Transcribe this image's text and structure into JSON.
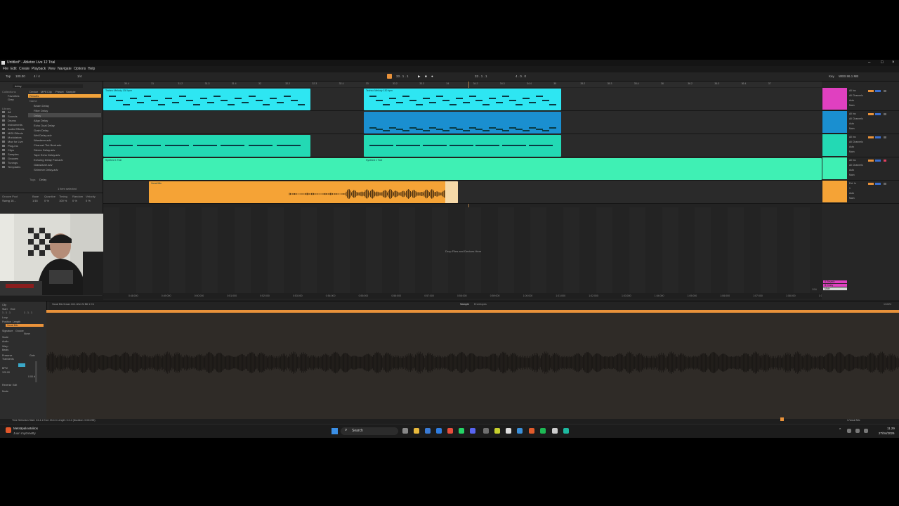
{
  "window": {
    "title": "Untitled* - Ableton Live 12 Trial"
  },
  "menu": [
    "File",
    "Edit",
    "Create",
    "Playback",
    "View",
    "Navigate",
    "Options",
    "Help"
  ],
  "transport": {
    "tap": "Tap",
    "bpm": "100.00",
    "time_sig": "4 / 4",
    "quantize": "1/4",
    "position": "33 . 1 . 1",
    "loop_length": "4 . 0 . 0",
    "keys": "Key",
    "midi": "MIDI",
    "cpu": "WEB 86.1 MB"
  },
  "browser": {
    "search": "delay",
    "filter_tabs": [
      "Device",
      "MPE",
      "Clip",
      "Preset",
      "Sample"
    ],
    "collections_label": "Collections",
    "collections": [
      "Favorites",
      "Grey"
    ],
    "library_label": "Library",
    "library": [
      "All",
      "Sounds",
      "Drums",
      "Instruments",
      "Audio Effects",
      "MIDI Effects",
      "Modulators",
      "Max for Live",
      "Plug-Ins",
      "Clips",
      "Samples",
      "Grooves",
      "Tunings",
      "Templates"
    ],
    "results_label": "Results",
    "results_header": "Name",
    "results": [
      "Beam Delay",
      "Filter Delay",
      "Delay",
      "Align Delay",
      "Echo Dual Delay",
      "Grain Delay",
      "Wet Delay.adv",
      "Wanderer.adv",
      "Channel Tint Beat.adv",
      "Stereo Delay.adv",
      "Tape Echo Delay.adv",
      "Echoing Delay Pad.adv",
      "Glassdune.adv",
      "Shimmer Delay.adv"
    ],
    "tags_label": "Tags",
    "tags_value": "Delay",
    "selected_count": "1 item selected",
    "groove_cols": [
      "Groove Pool",
      "Base",
      "Quantize",
      "Timing",
      "Random",
      "Velocity"
    ],
    "groove_row": [
      "Swing 16...",
      "1/16",
      "0 %",
      "100 %",
      "0 %",
      "0 %"
    ]
  },
  "ruler": [
    "30.4",
    "31",
    "31.2",
    "31.3",
    "31.4",
    "32",
    "32.2",
    "32.3",
    "32.4",
    "33",
    "33.2",
    "33.3",
    "34",
    "34.2",
    "34.3",
    "34.4",
    "35",
    "35.2",
    "35.3",
    "35.4",
    "36",
    "36.2",
    "36.3",
    "36.4",
    "37"
  ],
  "tracks": [
    {
      "name": "1 Wavetable",
      "color": "#2ee6f2",
      "clips": [
        {
          "label": "Techno Melody 130 bpm"
        },
        {
          "label": "Techno Melody 130 bpm"
        }
      ]
    },
    {
      "name": "2 MIDI",
      "color": "#1a8fd0",
      "clips": [
        {
          "label": ""
        }
      ]
    },
    {
      "name": "3 Drum Rack",
      "color": "#23d9b4",
      "clips": [
        {
          "label": ""
        },
        {
          "label": ""
        }
      ]
    },
    {
      "name": "4 Audio",
      "color": "#3ff0b4",
      "clips": [
        {
          "label": "Synthed 1 Tide"
        },
        {
          "label": "Synthed 1 Tide"
        }
      ]
    },
    {
      "name": "5 Vocal",
      "color": "#f5a336",
      "clips": [
        {
          "label": "Vocal Mic"
        }
      ]
    }
  ],
  "mixer": {
    "strips": [
      {
        "input": "All Ins",
        "channel": "All Channels",
        "monitor": "Auto",
        "output": "Main",
        "color": "#e040c0"
      },
      {
        "input": "All Ins",
        "channel": "All Channels",
        "monitor": "Auto",
        "output": "Main",
        "color": "#1a8fd0"
      },
      {
        "input": "All Ins",
        "channel": "All Channels",
        "monitor": "Auto",
        "output": "Main",
        "color": "#23d9b4"
      },
      {
        "input": "All Ins",
        "channel": "All Channels",
        "monitor": "Auto",
        "output": "Main",
        "color": "#3ff0b4"
      },
      {
        "input": "Ext. In",
        "channel": "1",
        "monitor": "Auto",
        "output": "Main",
        "color": "#f5a336"
      }
    ],
    "returns": [
      "A Reverb",
      "B Delay",
      "Main"
    ],
    "zoom": "1/16"
  },
  "drop_text": "Drop Files and Devices Here",
  "timeline": [
    "0:48:000",
    "0:49:000",
    "0:50:000",
    "0:51:000",
    "0:52:000",
    "0:53:000",
    "0:54:000",
    "0:55:000",
    "0:56:000",
    "0:57:000",
    "0:58:000",
    "0:59:000",
    "1:00:000",
    "1:01:000",
    "1:02:000",
    "1:03:000",
    "1:04:000",
    "1:05:000",
    "1:06:000",
    "1:07:000",
    "1:08:000",
    "1:09:000"
  ],
  "detail": {
    "clip_name": "Vocal Mic",
    "sample_info": "Vocal Mic 5.wav  44.1 kHz  24 Bit  1 Ch",
    "tabs": [
      "Sample",
      "Envelopes"
    ],
    "position": "1/1024",
    "labels": [
      "Clip",
      "Start",
      "End",
      "Loop",
      "Position",
      "Length",
      "Signature",
      "Groove",
      "Scale",
      "Audio",
      "Warp",
      "Beats",
      "Preserve",
      "Transients",
      "BPM",
      "Reverse",
      "Edit",
      "Gain",
      "Mode"
    ],
    "start": "1 . 1 . 1",
    "end": "1 . 1 . 1",
    "bpm": "120.00",
    "gain": "0.00 dB",
    "groove": "None"
  },
  "status": {
    "text": "Time Selection  Start: 33.4.1  End: 33.4.3  Length: 0.0.2  (Duration: 0:00:295)",
    "right": "3-Vocal Mic"
  },
  "taskbar": {
    "notif_line1": "Metsäpaloväriitos",
    "notif_line2": "Juuri myönnetty",
    "search": "Search",
    "time": "11.29",
    "date": "27/04/2026"
  },
  "colors": {
    "cyan": "#2ee6f2",
    "blue": "#1a8fd0",
    "teal": "#23d9b4",
    "mint": "#3ff0b4",
    "orange": "#f5a336",
    "pink": "#e040c0"
  }
}
